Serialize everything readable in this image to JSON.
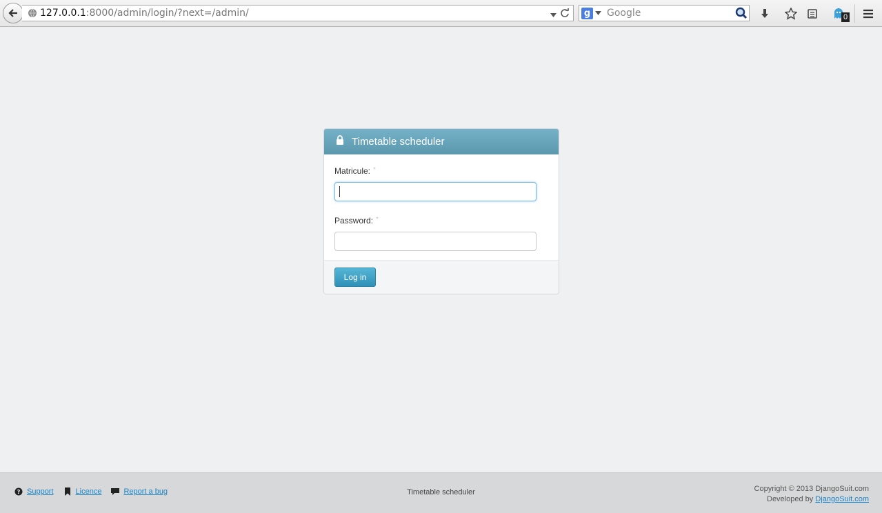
{
  "browser": {
    "url_host": "127.0.0.1",
    "url_rest": ":8000/admin/login/?next=/admin/",
    "search_placeholder": "Google",
    "search_engine_letter": "g",
    "ghostery_badge": "0"
  },
  "login": {
    "title": "Timetable scheduler",
    "fields": [
      {
        "label": "Matricule:",
        "required_mark": "*",
        "value": ""
      },
      {
        "label": "Password:",
        "required_mark": "*",
        "value": ""
      }
    ],
    "submit_label": "Log in"
  },
  "footer": {
    "links": [
      {
        "label": "Support",
        "icon": "question-circle-icon"
      },
      {
        "label": "Licence",
        "icon": "bookmark-icon"
      },
      {
        "label": "Report a bug",
        "icon": "comment-icon"
      }
    ],
    "center_text": "Timetable scheduler",
    "copyright": "Copyright © 2013 DjangoSuit.com",
    "developed_by": "Developed by",
    "developer_link": "DjangoSuit.com"
  },
  "colors": {
    "page_bg": "#eef0f2",
    "panel_header": "#5b97ad",
    "button": "#2f91b7",
    "link": "#1a85c8",
    "footer_bg": "#d7d8d9"
  }
}
